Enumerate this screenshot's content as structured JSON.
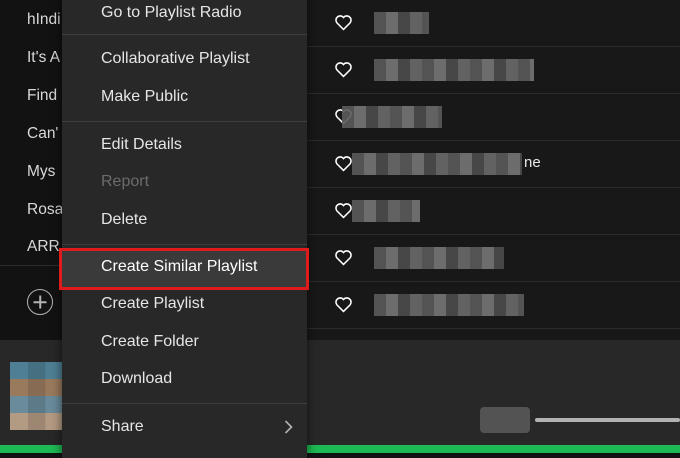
{
  "sidebar": {
    "playlists": [
      "hIndi",
      "It's A",
      "Find",
      "Can'",
      "Mys",
      "Rosa",
      "ARR"
    ],
    "add_icon": "plus-circle-icon"
  },
  "context_menu": {
    "items": [
      {
        "label": "Go to Playlist Radio",
        "disabled": false
      },
      {
        "label": "Collaborative Playlist",
        "disabled": false
      },
      {
        "label": "Make Public",
        "disabled": false
      },
      {
        "label": "Edit Details",
        "disabled": false
      },
      {
        "label": "Report",
        "disabled": true
      },
      {
        "label": "Delete",
        "disabled": false
      },
      {
        "label": "Create Similar Playlist",
        "disabled": false,
        "highlighted": true
      },
      {
        "label": "Create Playlist",
        "disabled": false
      },
      {
        "label": "Create Folder",
        "disabled": false
      },
      {
        "label": "Download",
        "disabled": false
      },
      {
        "label": "Share",
        "disabled": false,
        "submenu": true
      }
    ],
    "highlight_color": "#e01b1b"
  },
  "tracklist": {
    "rows": [
      {
        "suffix": ""
      },
      {
        "suffix": ""
      },
      {
        "suffix": ""
      },
      {
        "suffix": "ne"
      },
      {
        "suffix": ""
      },
      {
        "suffix": ""
      },
      {
        "suffix": ""
      }
    ],
    "icon": "heart-icon"
  },
  "player": {
    "accent_color": "#1db954"
  }
}
